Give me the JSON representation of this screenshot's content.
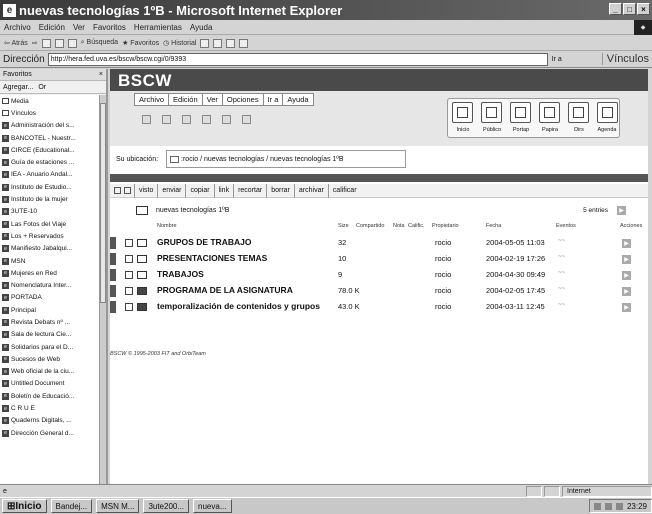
{
  "window": {
    "title": "nuevas tecnologías 1ºB - Microsoft Internet Explorer"
  },
  "menubar": [
    "Archivo",
    "Edición",
    "Ver",
    "Favoritos",
    "Herramientas",
    "Ayuda"
  ],
  "toolbar": {
    "back": "Atrás",
    "search": "Búsqueda",
    "favorites": "Favoritos",
    "history": "Historial"
  },
  "address": {
    "label": "Dirección",
    "url": "http://hera.fed.uva.es/bscw/bscw.cgi/0/9393",
    "go": "Ir a",
    "links": "Vínculos"
  },
  "sidebar": {
    "title": "Favoritos",
    "add": "Agregar...",
    "organize": "Or",
    "items": [
      "Media",
      "Vínculos",
      "Administración del s...",
      "BANCOTEL - Nuestr...",
      "CIRCE (Educational...",
      "Guía de estaciones ...",
      "IEA - Anuario Andal...",
      "Instituto de Estudio...",
      "Instituto de la mujer",
      "3UTE-10",
      "Las Fotos del Viaje",
      "Los + Reservados",
      "Manifiesto Jabalqui...",
      "MSN",
      "Mujeres en Red",
      "Nomenclatura Inter...",
      "PORTADA",
      "Principal",
      "Revista Debats nº ...",
      "Sala de lectura Cie...",
      "Solidarios para el D...",
      "Sucesos de Web",
      "Web oficial de la ciu...",
      "Untitled Document",
      "Boletín de Educació...",
      "C R U E",
      "Quaderns Digitals, ...",
      "Dirección General d..."
    ]
  },
  "bscw": {
    "logo": "BSCW",
    "menu": [
      "Archivo",
      "Edición",
      "Ver",
      "Opciones",
      "Ir a",
      "Ayuda"
    ],
    "nav": [
      "Inicio",
      "Público",
      "Portap",
      "Papira",
      "Dirs",
      "Agenda"
    ],
    "location_label": "Su ubicación:",
    "location_path": ":rocio / nuevas tecnologías / nuevas tecnologías 1ºB",
    "actions": [
      "visto",
      "enviar",
      "copiar",
      "link",
      "recortar",
      "borrar",
      "archivar",
      "calificar"
    ],
    "folder": {
      "name": "nuevas tecnologías 1ºB",
      "entries": "5 entries"
    },
    "columns": [
      "Nombre",
      "Size",
      "Compartido",
      "Nota",
      "Calific.",
      "Propietario",
      "Fecha",
      "Eventos",
      "Acciones"
    ],
    "rows": [
      {
        "name": "GRUPOS DE TRABAJO",
        "size": "32",
        "owner": "rocio",
        "date": "2004-05-05 11:03",
        "events": "~~",
        "type": "folder"
      },
      {
        "name": "PRESENTACIONES TEMAS",
        "size": "10",
        "owner": "rocio",
        "date": "2004-02-19 17:26",
        "events": "~~",
        "type": "folder"
      },
      {
        "name": "TRABAJOS",
        "size": "9",
        "owner": "rocio",
        "date": "2004-04-30 09:49",
        "events": "~~",
        "type": "folder"
      },
      {
        "name": "PROGRAMA DE LA ASIGNATURA",
        "size": "78.0 K",
        "owner": "rocio",
        "date": "2004-02-05 17:45",
        "events": "~~",
        "type": "doc"
      },
      {
        "name": "temporalización de contenidos y grupos",
        "size": "43.0 K",
        "owner": "rocio",
        "date": "2004-03-11 12:45",
        "events": "~~",
        "type": "doc"
      }
    ],
    "footer": "BSCW © 1995-2003 FIT and OrbiTeam"
  },
  "statusbar": {
    "zone": "Internet"
  },
  "taskbar": {
    "start": "Inicio",
    "buttons": [
      "Bandej...",
      "MSN M...",
      "3ute200...",
      "nueva..."
    ],
    "clock": "23:29"
  }
}
